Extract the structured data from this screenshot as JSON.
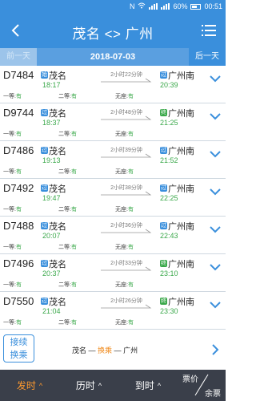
{
  "status_bar": {
    "network": "N",
    "battery": "60%",
    "time": "00:51"
  },
  "header": {
    "title": "茂名 <> 广州"
  },
  "date_bar": {
    "prev_label": "前一天",
    "date": "2018-07-03",
    "next_label": "后一天"
  },
  "trains": [
    {
      "no": "D7484",
      "from_icon": "始",
      "from": "茂名",
      "dep": "18:17",
      "duration": "2小时22分钟",
      "to_icon": "过",
      "to": "广州南",
      "arr": "20:39",
      "seats": [
        {
          "label": "一等:",
          "value": "有"
        },
        {
          "label": "二等:",
          "value": "有"
        },
        {
          "label": "无座:",
          "value": "有"
        }
      ]
    },
    {
      "no": "D9744",
      "from_icon": "过",
      "from": "茂名",
      "dep": "18:37",
      "duration": "2小时48分钟",
      "to_icon": "终",
      "to": "广州南",
      "arr": "21:25",
      "seats": [
        {
          "label": "一等:",
          "value": "有"
        },
        {
          "label": "二等:",
          "value": "有"
        },
        {
          "label": "无座:",
          "value": "有"
        }
      ]
    },
    {
      "no": "D7486",
      "from_icon": "过",
      "from": "茂名",
      "dep": "19:13",
      "duration": "2小时39分钟",
      "to_icon": "过",
      "to": "广州南",
      "arr": "21:52",
      "seats": [
        {
          "label": "一等:",
          "value": "有"
        },
        {
          "label": "二等:",
          "value": "有"
        },
        {
          "label": "无座:",
          "value": "有"
        }
      ]
    },
    {
      "no": "D7492",
      "from_icon": "过",
      "from": "茂名",
      "dep": "19:47",
      "duration": "2小时38分钟",
      "to_icon": "过",
      "to": "广州南",
      "arr": "22:25",
      "seats": [
        {
          "label": "一等:",
          "value": "有"
        },
        {
          "label": "二等:",
          "value": "有"
        },
        {
          "label": "无座:",
          "value": "有"
        }
      ]
    },
    {
      "no": "D7488",
      "from_icon": "过",
      "from": "茂名",
      "dep": "20:07",
      "duration": "2小时36分钟",
      "to_icon": "过",
      "to": "广州南",
      "arr": "22:43",
      "seats": [
        {
          "label": "一等:",
          "value": "有"
        },
        {
          "label": "二等:",
          "value": "有"
        },
        {
          "label": "无座:",
          "value": "有"
        }
      ]
    },
    {
      "no": "D7496",
      "from_icon": "过",
      "from": "茂名",
      "dep": "20:37",
      "duration": "2小时33分钟",
      "to_icon": "终",
      "to": "广州南",
      "arr": "23:10",
      "seats": [
        {
          "label": "一等:",
          "value": "有"
        },
        {
          "label": "二等:",
          "value": "有"
        },
        {
          "label": "无座:",
          "value": "有"
        }
      ]
    },
    {
      "no": "D7550",
      "from_icon": "过",
      "from": "茂名",
      "dep": "21:04",
      "duration": "2小时26分钟",
      "to_icon": "终",
      "to": "广州南",
      "arr": "23:30",
      "seats": [
        {
          "label": "一等:",
          "value": "有"
        },
        {
          "label": "二等:",
          "value": "有"
        },
        {
          "label": "无座:",
          "value": "有"
        }
      ]
    }
  ],
  "transfer": {
    "button_line1": "接续",
    "button_line2": "换乘",
    "route_from": "茂名",
    "route_mid": "换乘",
    "route_to": "广州"
  },
  "bottom_tabs": {
    "depart": "发时",
    "duration": "历时",
    "arrive": "到时",
    "price": "票价",
    "remaining": "余票",
    "caret": "^"
  },
  "colors": {
    "primary": "#3a8fdc",
    "available": "#3aa84a",
    "accent": "#ff9a2e",
    "bottom_bar": "#3a3f4a"
  }
}
